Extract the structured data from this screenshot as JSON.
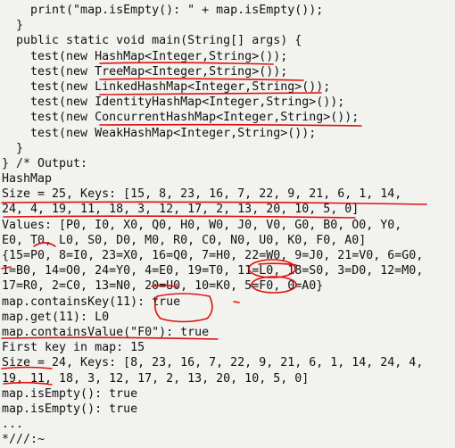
{
  "code": {
    "lines": [
      "    print(\"map.isEmpty(): \" + map.isEmpty());",
      "  }",
      "  public static void main(String[] args) {",
      "    test(new HashMap<Integer,String>());",
      "    test(new TreeMap<Integer,String>());",
      "    test(new LinkedHashMap<Integer,String>());",
      "    test(new IdentityHashMap<Integer,String>());",
      "    test(new ConcurrentHashMap<Integer,String>());",
      "    test(new WeakHashMap<Integer,String>());",
      "  }",
      "} /* Output:",
      "HashMap",
      "Size = 25, Keys: [15, 8, 23, 16, 7, 22, 9, 21, 6, 1, 14,",
      "24, 4, 19, 11, 18, 3, 12, 17, 2, 13, 20, 10, 5, 0]",
      "Values: [P0, I0, X0, Q0, H0, W0, J0, V0, G0, B0, O0, Y0,",
      "E0, T0, L0, S0, D0, M0, R0, C0, N0, U0, K0, F0, A0]",
      "{15=P0, 8=I0, 23=X0, 16=Q0, 7=H0, 22=W0, 9=J0, 21=V0, 6=G0,",
      "1=B0, 14=O0, 24=Y0, 4=E0, 19=T0, 11=L0, 18=S0, 3=D0, 12=M0,",
      "17=R0, 2=C0, 13=N0, 20=U0, 10=K0, 5=F0, 0=A0}",
      "map.containsKey(11): true",
      "map.get(11): L0",
      "map.containsValue(\"F0\"): true",
      "First key in map: 15",
      "Size = 24, Keys: [8, 23, 16, 7, 22, 9, 21, 6, 1, 14, 24, 4,",
      "19, 11, 18, 3, 12, 17, 2, 13, 20, 10, 5, 0]",
      "map.isEmpty(): true",
      "map.isEmpty(): true",
      "...",
      "*///:~"
    ]
  },
  "colors": {
    "background": "#f2f2ee",
    "text": "#111111",
    "annotation": "#dd1111"
  }
}
